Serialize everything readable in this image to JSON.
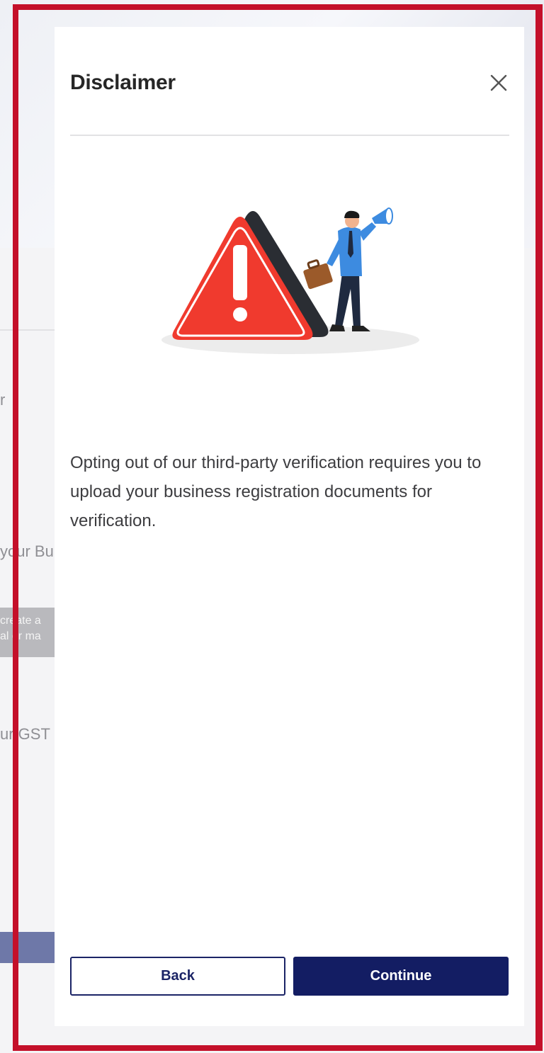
{
  "background_page": {
    "fragments": [
      "r",
      "your Bu",
      "ur GST"
    ],
    "chip_lines": [
      "create a",
      "al or ma"
    ]
  },
  "modal": {
    "title": "Disclaimer",
    "close_icon": "close-icon",
    "illustration": "warning-triangle-with-person-megaphone",
    "message": "Opting out of our third-party verification requires you to upload your business registration documents for verification.",
    "buttons": {
      "back_label": "Back",
      "continue_label": "Continue"
    }
  },
  "colors": {
    "highlight_frame": "#c4102a",
    "primary_button": "#131d63",
    "warning_red": "#f03a2e"
  }
}
